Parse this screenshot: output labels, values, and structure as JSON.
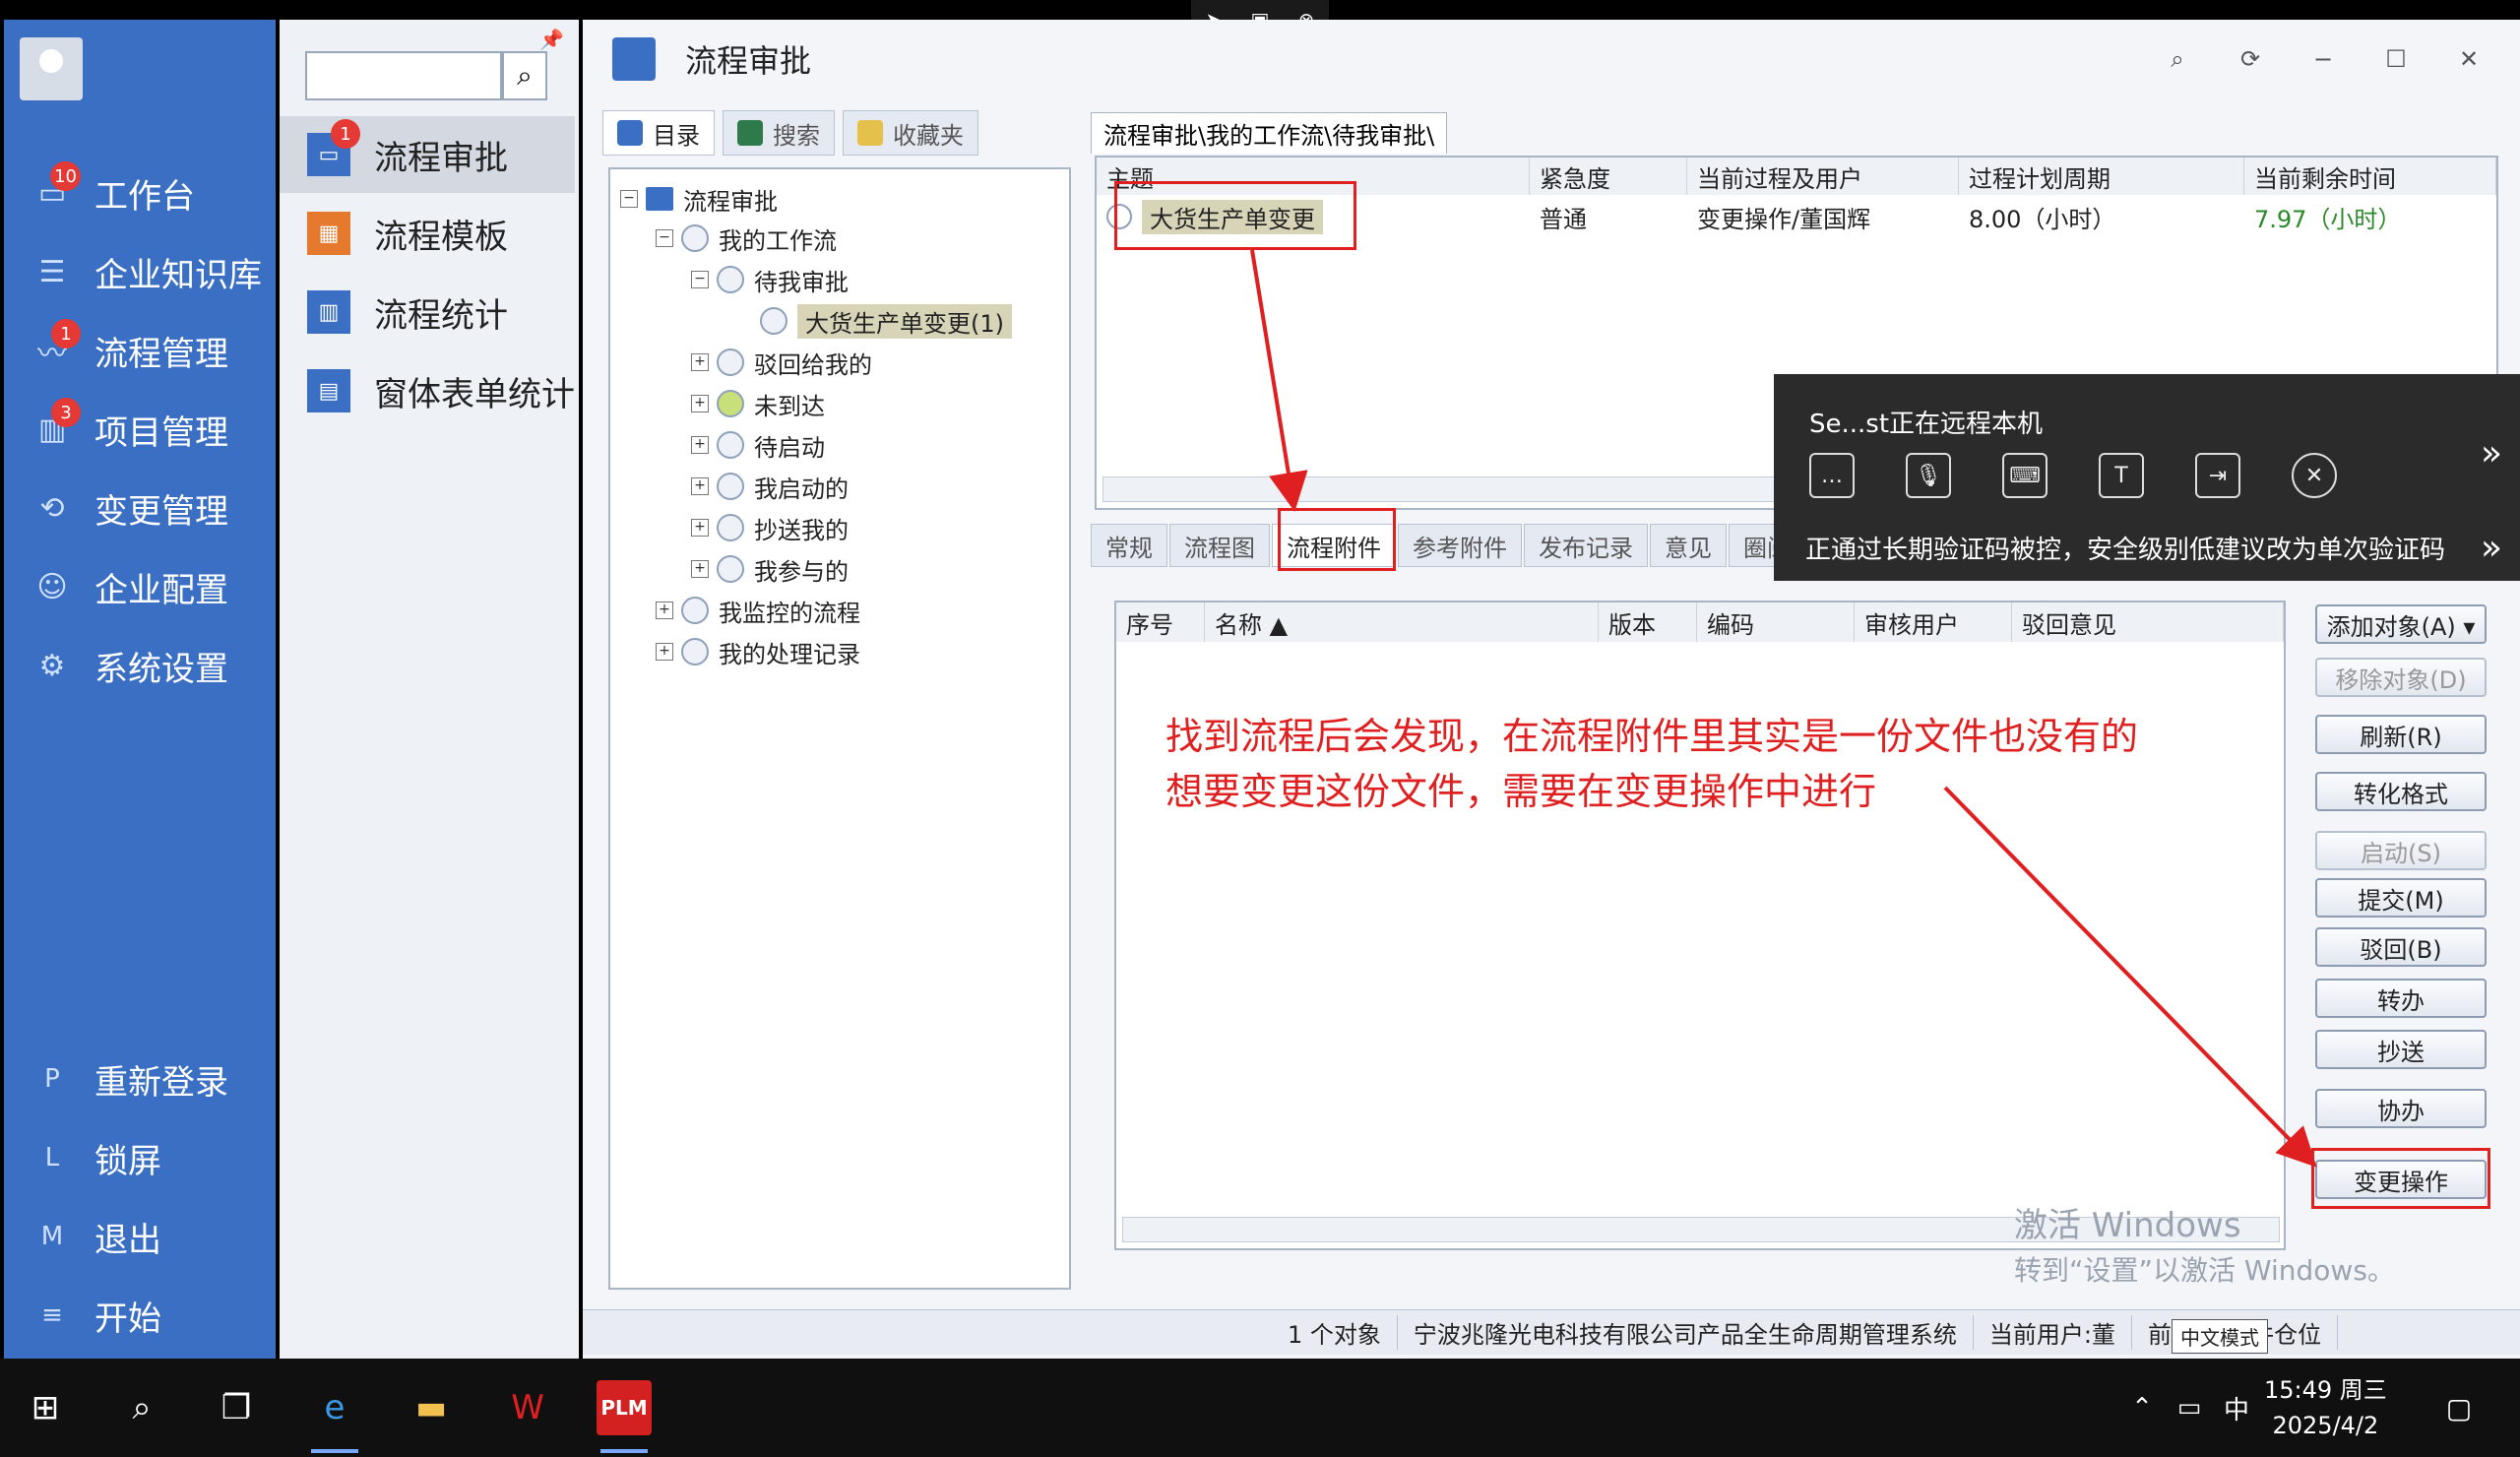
{
  "leftnav": {
    "items": [
      {
        "label": "工作台",
        "badge": "10",
        "icon": "monitor-icon"
      },
      {
        "label": "企业知识库",
        "badge": "",
        "icon": "list-icon"
      },
      {
        "label": "流程管理",
        "badge": "1",
        "icon": "flow-icon"
      },
      {
        "label": "项目管理",
        "badge": "3",
        "icon": "chart-icon"
      },
      {
        "label": "变更管理",
        "badge": "",
        "icon": "change-icon"
      },
      {
        "label": "企业配置",
        "badge": "",
        "icon": "users-icon"
      },
      {
        "label": "系统设置",
        "badge": "",
        "icon": "gear-icon"
      }
    ],
    "bottom": [
      {
        "key": "P",
        "label": "重新登录"
      },
      {
        "key": "L",
        "label": "锁屏"
      },
      {
        "key": "M",
        "label": "退出"
      },
      {
        "key": "≡",
        "label": "开始"
      }
    ]
  },
  "subnav": {
    "items": [
      {
        "label": "流程审批",
        "badge": "1",
        "active": true,
        "color": "#3a6fc4"
      },
      {
        "label": "流程模板",
        "badge": "",
        "active": false,
        "color": "#e57a2e"
      },
      {
        "label": "流程统计",
        "badge": "",
        "active": false,
        "color": "#3a6fc4"
      },
      {
        "label": "窗体表单统计",
        "badge": "",
        "active": false,
        "color": "#3a6fc4"
      }
    ]
  },
  "window": {
    "title": "流程审批"
  },
  "left_tabs": [
    "目录",
    "搜索",
    "收藏夹"
  ],
  "tree": [
    {
      "label": "流程审批",
      "level": 0,
      "exp": "−"
    },
    {
      "label": "我的工作流",
      "level": 1,
      "exp": "−"
    },
    {
      "label": "待我审批",
      "level": 2,
      "exp": "−"
    },
    {
      "label": "大货生产单变更(1)",
      "level": 3,
      "exp": ""
    },
    {
      "label": "驳回给我的",
      "level": 2,
      "exp": "+"
    },
    {
      "label": "未到达",
      "level": 2,
      "exp": "+"
    },
    {
      "label": "待启动",
      "level": 2,
      "exp": "+"
    },
    {
      "label": "我启动的",
      "level": 2,
      "exp": "+"
    },
    {
      "label": "抄送我的",
      "level": 2,
      "exp": "+"
    },
    {
      "label": "我参与的",
      "level": 2,
      "exp": "+"
    },
    {
      "label": "我监控的流程",
      "level": 1,
      "exp": "+"
    },
    {
      "label": "我的处理记录",
      "level": 1,
      "exp": "+"
    }
  ],
  "path_tab": "流程审批\\我的工作流\\待我审批\\",
  "top_grid": {
    "headers": [
      "主题",
      "紧急度",
      "当前过程及用户",
      "过程计划周期",
      "当前剩余时间"
    ],
    "row": [
      "大货生产单变更",
      "普通",
      "变更操作/董国辉",
      "8.00（小时）",
      "7.97（小时）"
    ]
  },
  "detail_tabs": [
    "常规",
    "流程图",
    "流程附件",
    "参考附件",
    "发布记录",
    "意见",
    "圈阅"
  ],
  "bottom_grid": {
    "headers": [
      "序号",
      "名称 ▲",
      "版本",
      "编码",
      "审核用户",
      "驳回意见"
    ]
  },
  "side_buttons": [
    {
      "label": "添加对象(A) ▾",
      "disabled": false
    },
    {
      "label": "移除对象(D)",
      "disabled": true
    },
    {
      "label": "刷新(R)",
      "disabled": false
    },
    {
      "label": "转化格式",
      "disabled": false
    },
    {
      "label": "启动(S)",
      "disabled": true
    },
    {
      "label": "提交(M)",
      "disabled": false
    },
    {
      "label": "驳回(B)",
      "disabled": false
    },
    {
      "label": "转办",
      "disabled": false
    },
    {
      "label": "抄送",
      "disabled": false
    },
    {
      "label": "协办",
      "disabled": false
    },
    {
      "label": "变更操作",
      "disabled": false
    }
  ],
  "annotation": {
    "line1": "找到流程后会发现，在流程附件里其实是一份文件也没有的",
    "line2": "想要变更这份文件，需要在变更操作中进行"
  },
  "statusbar": {
    "count": "1 个对象",
    "company": "宁波兆隆光电科技有限公司产品全生命周期管理系统",
    "user": "当前用户:董",
    "location": "前仓位:文件仓位"
  },
  "watermark": {
    "line1": "激活 Windows",
    "line2": "转到“设置”以激活 Windows。"
  },
  "remote": {
    "who": "Se...st正在远程本机",
    "warning": "正通过长期验证码被控，安全级别低建议改为单次验证码",
    "tools": [
      "chat-icon",
      "mic-icon",
      "keyboard-icon",
      "text-icon",
      "folder-icon",
      "close-icon"
    ]
  },
  "taskbar": {
    "time": "15:49 周三",
    "date": "2025/4/2",
    "ime": "中",
    "ime_tip": "中文模式"
  }
}
